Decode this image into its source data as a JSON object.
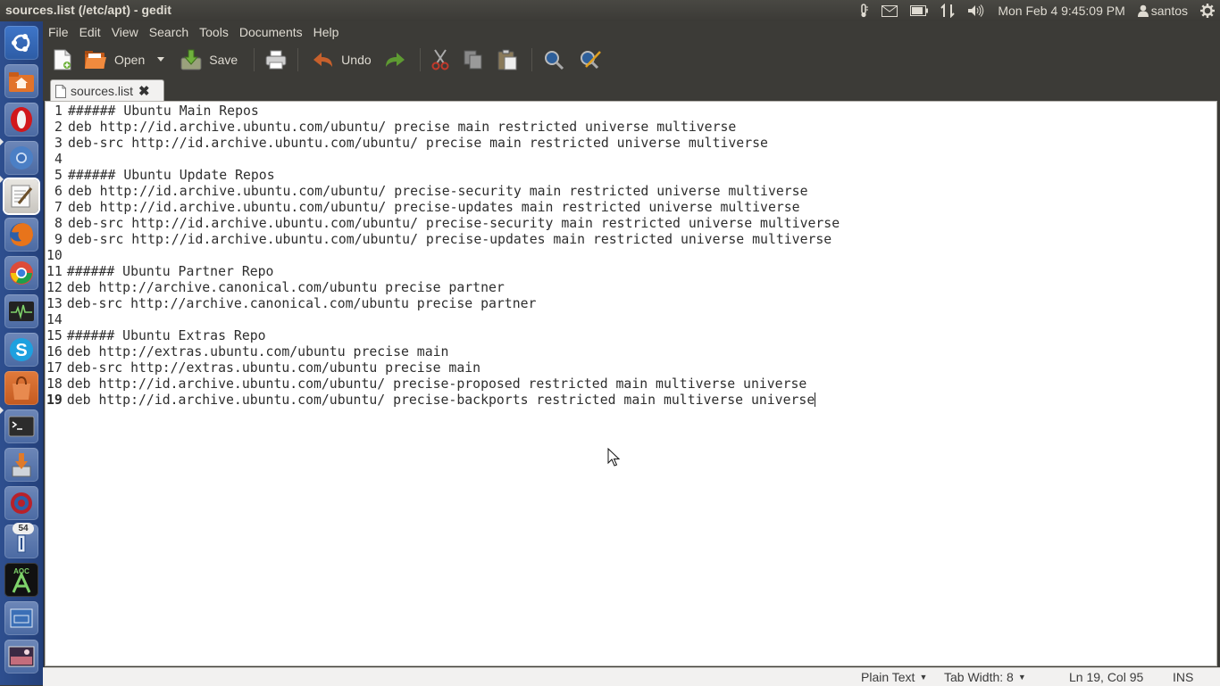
{
  "window": {
    "title": "sources.list (/etc/apt) - gedit"
  },
  "panel": {
    "clock": "Mon Feb  4  9:45:09 PM",
    "user": "santos",
    "indicators": [
      "thermometer-icon",
      "mail-icon",
      "battery-icon",
      "network-icon",
      "volume-icon",
      "user-icon",
      "gear-icon"
    ]
  },
  "launcher": {
    "items": [
      {
        "name": "dash-home",
        "color": "#3a6fc4"
      },
      {
        "name": "files",
        "color": "#e06b1e"
      },
      {
        "name": "opera",
        "color": "#cc1b1b"
      },
      {
        "name": "chromium",
        "color": "#4a90d9"
      },
      {
        "name": "gedit",
        "color": "#d8d6d0"
      },
      {
        "name": "firefox",
        "color": "#e8741b"
      },
      {
        "name": "chrome",
        "color": "#dd4b39"
      },
      {
        "name": "system-monitor",
        "color": "#2b2b2b"
      },
      {
        "name": "skype",
        "color": "#1ea0df"
      },
      {
        "name": "software-center",
        "color": "#d7622a"
      },
      {
        "name": "terminal",
        "color": "#2c2c2c"
      },
      {
        "name": "update-manager",
        "color": "#5b87c5"
      },
      {
        "name": "network-tool",
        "color": "#b8212a"
      },
      {
        "name": "tasks-app",
        "color": "#3b6fb6"
      },
      {
        "name": "android-studio",
        "color": "#1e1e1e"
      },
      {
        "name": "workspace-switcher",
        "color": "#3b6fb6"
      },
      {
        "name": "trash",
        "color": "#6a4b6e"
      }
    ],
    "badge": "54"
  },
  "menubar": {
    "items": [
      "File",
      "Edit",
      "View",
      "Search",
      "Tools",
      "Documents",
      "Help"
    ]
  },
  "toolbar": {
    "open_label": "Open",
    "save_label": "Save",
    "undo_label": "Undo"
  },
  "tab": {
    "label": "sources.list"
  },
  "editor": {
    "lines": [
      {
        "num": "1",
        "text": "###### Ubuntu Main Repos"
      },
      {
        "num": "2",
        "text": "deb http://id.archive.ubuntu.com/ubuntu/ precise main restricted universe multiverse"
      },
      {
        "num": "3",
        "text": "deb-src http://id.archive.ubuntu.com/ubuntu/ precise main restricted universe multiverse"
      },
      {
        "num": "4",
        "text": ""
      },
      {
        "num": "5",
        "text": "###### Ubuntu Update Repos"
      },
      {
        "num": "6",
        "text": "deb http://id.archive.ubuntu.com/ubuntu/ precise-security main restricted universe multiverse"
      },
      {
        "num": "7",
        "text": "deb http://id.archive.ubuntu.com/ubuntu/ precise-updates main restricted universe multiverse"
      },
      {
        "num": "8",
        "text": "deb-src http://id.archive.ubuntu.com/ubuntu/ precise-security main restricted universe multiverse"
      },
      {
        "num": "9",
        "text": "deb-src http://id.archive.ubuntu.com/ubuntu/ precise-updates main restricted universe multiverse"
      },
      {
        "num": "10",
        "text": ""
      },
      {
        "num": "11",
        "text": "###### Ubuntu Partner Repo"
      },
      {
        "num": "12",
        "text": "deb http://archive.canonical.com/ubuntu precise partner"
      },
      {
        "num": "13",
        "text": "deb-src http://archive.canonical.com/ubuntu precise partner"
      },
      {
        "num": "14",
        "text": ""
      },
      {
        "num": "15",
        "text": "###### Ubuntu Extras Repo"
      },
      {
        "num": "16",
        "text": "deb http://extras.ubuntu.com/ubuntu precise main"
      },
      {
        "num": "17",
        "text": "deb-src http://extras.ubuntu.com/ubuntu precise main"
      },
      {
        "num": "18",
        "text": "deb http://id.archive.ubuntu.com/ubuntu/ precise-proposed restricted main multiverse universe"
      },
      {
        "num": "19",
        "text": "deb http://id.archive.ubuntu.com/ubuntu/ precise-backports restricted main multiverse universe"
      }
    ]
  },
  "statusbar": {
    "language": "Plain Text",
    "tab_width": "Tab Width: 8",
    "position": "Ln 19, Col 95",
    "mode": "INS"
  }
}
